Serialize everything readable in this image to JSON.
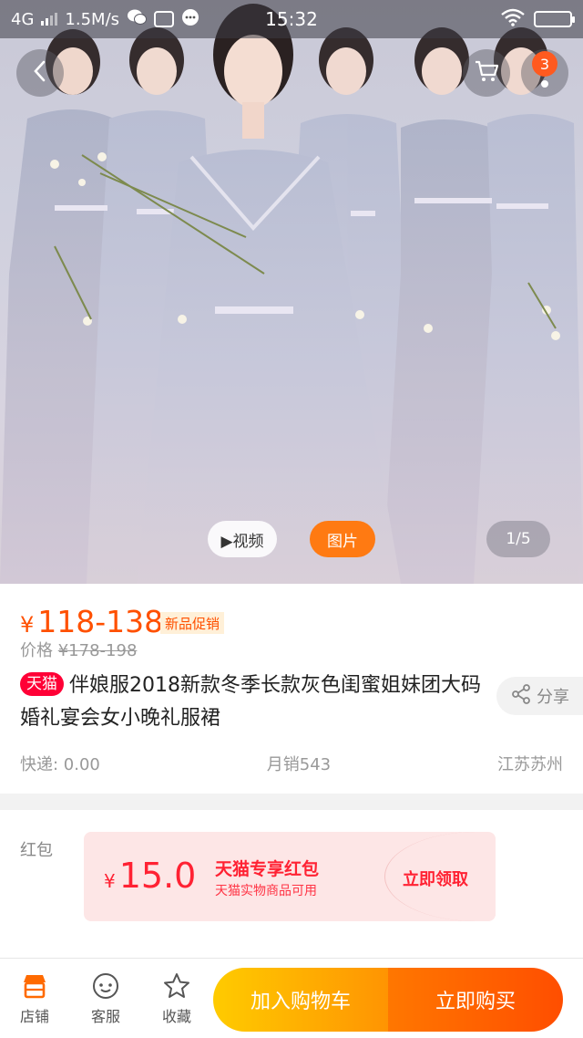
{
  "status_bar": {
    "network": "4G",
    "speed": "1.5M/s",
    "time": "15:32"
  },
  "header": {
    "cart_badge": "3"
  },
  "gallery": {
    "video_label": "▶视频",
    "photo_label": "图片",
    "page_indicator": "1/5"
  },
  "product": {
    "price_symbol": "¥",
    "price_range": "118-138",
    "promo_tag": "新品促销",
    "original_price_label": "价格",
    "original_price": "¥178-198",
    "store_tag": "天猫",
    "title": "伴娘服2018新款冬季长款灰色闺蜜姐妹团大码婚礼宴会女小晚礼服裙",
    "share_label": "分享",
    "shipping": "快递: 0.00",
    "monthly_sales": "月销543",
    "location": "江苏苏州"
  },
  "coupon": {
    "section_label": "红包",
    "symbol": "¥",
    "amount": "15.0",
    "title": "天猫专享红包",
    "subtitle": "天猫实物商品可用",
    "claim_label": "立即领取"
  },
  "bottom_bar": {
    "store_label": "店铺",
    "service_label": "客服",
    "favorite_label": "收藏",
    "add_to_cart_label": "加入购物车",
    "buy_now_label": "立即购买"
  },
  "colors": {
    "price_orange": "#ff5000",
    "tmall_red": "#ff0036",
    "coupon_red": "#ff2233",
    "cart_yellow": "#ffcb00",
    "buy_orange": "#ff4e00"
  },
  "icons": [
    "back-arrow-icon",
    "cart-icon",
    "more-icon",
    "share-icon",
    "store-icon",
    "service-icon",
    "star-icon",
    "wifi-icon",
    "battery-icon"
  ]
}
